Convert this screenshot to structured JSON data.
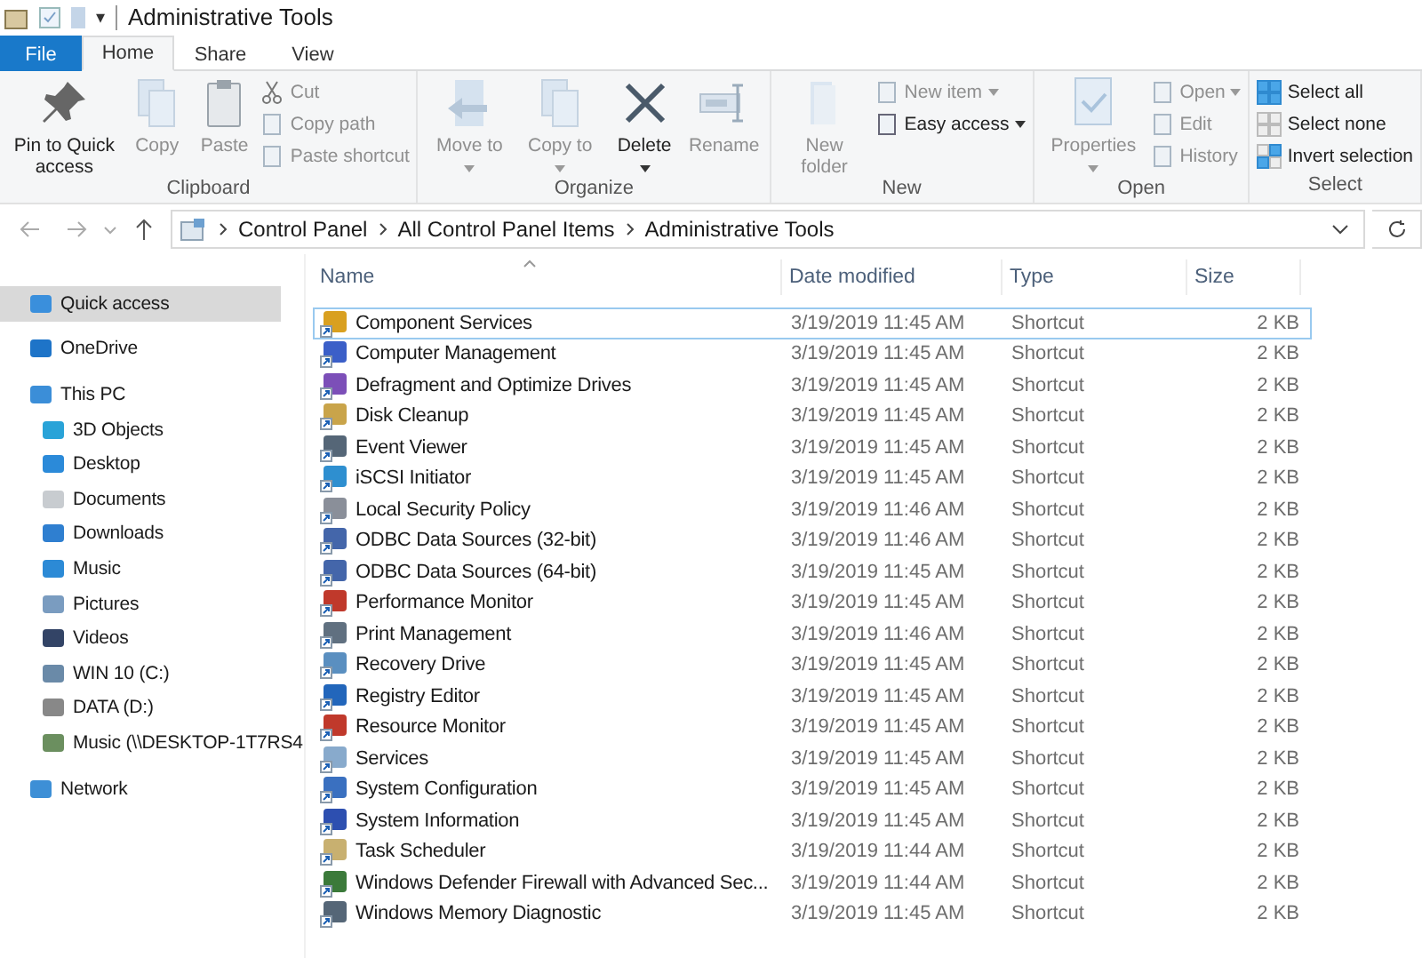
{
  "window": {
    "title": "Administrative Tools"
  },
  "quick_access_toolbar": {
    "dropdown": "▾"
  },
  "tabs": [
    {
      "label": "File",
      "kind": "file",
      "selected": false
    },
    {
      "label": "Home",
      "kind": "tab",
      "selected": true
    },
    {
      "label": "Share",
      "kind": "tab",
      "selected": false
    },
    {
      "label": "View",
      "kind": "tab",
      "selected": false
    }
  ],
  "ribbon": [
    {
      "label": "Clipboard",
      "items": [
        {
          "kind": "large",
          "label": "Pin to Quick access",
          "disabled": false,
          "caret": false
        },
        {
          "kind": "large",
          "label": "Copy",
          "disabled": true,
          "caret": false
        },
        {
          "kind": "large",
          "label": "Paste",
          "disabled": true,
          "caret": false
        },
        {
          "kind": "stack",
          "items": [
            {
              "label": "Cut",
              "disabled": true,
              "caret": false
            },
            {
              "label": "Copy path",
              "disabled": true,
              "caret": false
            },
            {
              "label": "Paste shortcut",
              "disabled": true,
              "caret": false
            }
          ]
        }
      ]
    },
    {
      "label": "Organize",
      "items": [
        {
          "kind": "large",
          "label": "Move to",
          "disabled": true,
          "caret": true
        },
        {
          "kind": "large",
          "label": "Copy to",
          "disabled": true,
          "caret": true
        },
        {
          "kind": "large",
          "label": "Delete",
          "disabled": false,
          "caret": true
        },
        {
          "kind": "large",
          "label": "Rename",
          "disabled": true,
          "caret": false
        }
      ]
    },
    {
      "label": "New",
      "items": [
        {
          "kind": "large",
          "label": "New folder",
          "disabled": true,
          "caret": false
        },
        {
          "kind": "stack",
          "items": [
            {
              "label": "New item",
              "disabled": true,
              "caret": true
            },
            {
              "label": "Easy access",
              "disabled": false,
              "caret": true
            }
          ]
        }
      ]
    },
    {
      "label": "Open",
      "items": [
        {
          "kind": "large",
          "label": "Properties",
          "disabled": true,
          "caret": true
        },
        {
          "kind": "stack",
          "items": [
            {
              "label": "Open",
              "disabled": true,
              "caret": true
            },
            {
              "label": "Edit",
              "disabled": true,
              "caret": false
            },
            {
              "label": "History",
              "disabled": true,
              "caret": false
            }
          ]
        }
      ]
    },
    {
      "label": "Select",
      "items": [
        {
          "kind": "stack",
          "items": [
            {
              "label": "Select all",
              "disabled": false,
              "caret": false
            },
            {
              "label": "Select none",
              "disabled": false,
              "caret": false
            },
            {
              "label": "Invert selection",
              "disabled": false,
              "caret": false
            }
          ]
        }
      ]
    }
  ],
  "address_bar": {
    "path": [
      "Control Panel",
      "All Control Panel Items",
      "Administrative Tools"
    ]
  },
  "navigation_pane": [
    {
      "label": "Quick access",
      "selected": true
    },
    {
      "label": "OneDrive",
      "selected": false
    },
    {
      "label": "This PC",
      "selected": false,
      "children": [
        {
          "label": "3D Objects",
          "selected": false
        },
        {
          "label": "Desktop",
          "selected": false
        },
        {
          "label": "Documents",
          "selected": false
        },
        {
          "label": "Downloads",
          "selected": false
        },
        {
          "label": "Music",
          "selected": false
        },
        {
          "label": "Pictures",
          "selected": false
        },
        {
          "label": "Videos",
          "selected": false
        },
        {
          "label": "WIN 10 (C:)",
          "selected": false
        },
        {
          "label": "DATA (D:)",
          "selected": false
        },
        {
          "label": "Music (\\\\DESKTOP-1T7RS4",
          "selected": false
        }
      ]
    },
    {
      "label": "Network",
      "selected": false
    }
  ],
  "table": {
    "columns": [
      "Name",
      "Date modified",
      "Type",
      "Size"
    ],
    "rows": [
      {
        "name": "Component Services",
        "date": "3/19/2019 11:45 AM",
        "type": "Shortcut",
        "size": "2 KB",
        "selected": true
      },
      {
        "name": "Computer Management",
        "date": "3/19/2019 11:45 AM",
        "type": "Shortcut",
        "size": "2 KB",
        "selected": false
      },
      {
        "name": "Defragment and Optimize Drives",
        "date": "3/19/2019 11:45 AM",
        "type": "Shortcut",
        "size": "2 KB",
        "selected": false
      },
      {
        "name": "Disk Cleanup",
        "date": "3/19/2019 11:45 AM",
        "type": "Shortcut",
        "size": "2 KB",
        "selected": false
      },
      {
        "name": "Event Viewer",
        "date": "3/19/2019 11:45 AM",
        "type": "Shortcut",
        "size": "2 KB",
        "selected": false
      },
      {
        "name": "iSCSI Initiator",
        "date": "3/19/2019 11:45 AM",
        "type": "Shortcut",
        "size": "2 KB",
        "selected": false
      },
      {
        "name": "Local Security Policy",
        "date": "3/19/2019 11:46 AM",
        "type": "Shortcut",
        "size": "2 KB",
        "selected": false
      },
      {
        "name": "ODBC Data Sources (32-bit)",
        "date": "3/19/2019 11:46 AM",
        "type": "Shortcut",
        "size": "2 KB",
        "selected": false
      },
      {
        "name": "ODBC Data Sources (64-bit)",
        "date": "3/19/2019 11:45 AM",
        "type": "Shortcut",
        "size": "2 KB",
        "selected": false
      },
      {
        "name": "Performance Monitor",
        "date": "3/19/2019 11:45 AM",
        "type": "Shortcut",
        "size": "2 KB",
        "selected": false
      },
      {
        "name": "Print Management",
        "date": "3/19/2019 11:46 AM",
        "type": "Shortcut",
        "size": "2 KB",
        "selected": false
      },
      {
        "name": "Recovery Drive",
        "date": "3/19/2019 11:45 AM",
        "type": "Shortcut",
        "size": "2 KB",
        "selected": false
      },
      {
        "name": "Registry Editor",
        "date": "3/19/2019 11:45 AM",
        "type": "Shortcut",
        "size": "2 KB",
        "selected": false
      },
      {
        "name": "Resource Monitor",
        "date": "3/19/2019 11:45 AM",
        "type": "Shortcut",
        "size": "2 KB",
        "selected": false
      },
      {
        "name": "Services",
        "date": "3/19/2019 11:45 AM",
        "type": "Shortcut",
        "size": "2 KB",
        "selected": false
      },
      {
        "name": "System Configuration",
        "date": "3/19/2019 11:45 AM",
        "type": "Shortcut",
        "size": "2 KB",
        "selected": false
      },
      {
        "name": "System Information",
        "date": "3/19/2019 11:45 AM",
        "type": "Shortcut",
        "size": "2 KB",
        "selected": false
      },
      {
        "name": "Task Scheduler",
        "date": "3/19/2019 11:44 AM",
        "type": "Shortcut",
        "size": "2 KB",
        "selected": false
      },
      {
        "name": "Windows Defender Firewall with Advanced Sec...",
        "date": "3/19/2019 11:44 AM",
        "type": "Shortcut",
        "size": "2 KB",
        "selected": false
      },
      {
        "name": "Windows Memory Diagnostic",
        "date": "3/19/2019 11:45 AM",
        "type": "Shortcut",
        "size": "2 KB",
        "selected": false
      }
    ]
  }
}
